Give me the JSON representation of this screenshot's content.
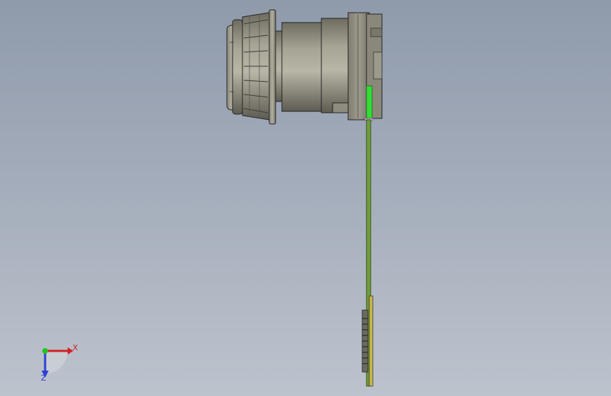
{
  "viewport": {
    "background_top": "#8f9aab",
    "background_bottom": "#bdc3cd"
  },
  "model": {
    "body_color": "#8f8d7d",
    "body_shade": "#6f6d60",
    "pcb_color": "#6f9e3a",
    "connector_color": "#c9b84a",
    "highlight_green": "#33dd33"
  },
  "triad": {
    "x_label": "X",
    "z_label": "Z",
    "x_color": "#d42020",
    "y_color": "#22c422",
    "z_color": "#2b3fd1"
  }
}
